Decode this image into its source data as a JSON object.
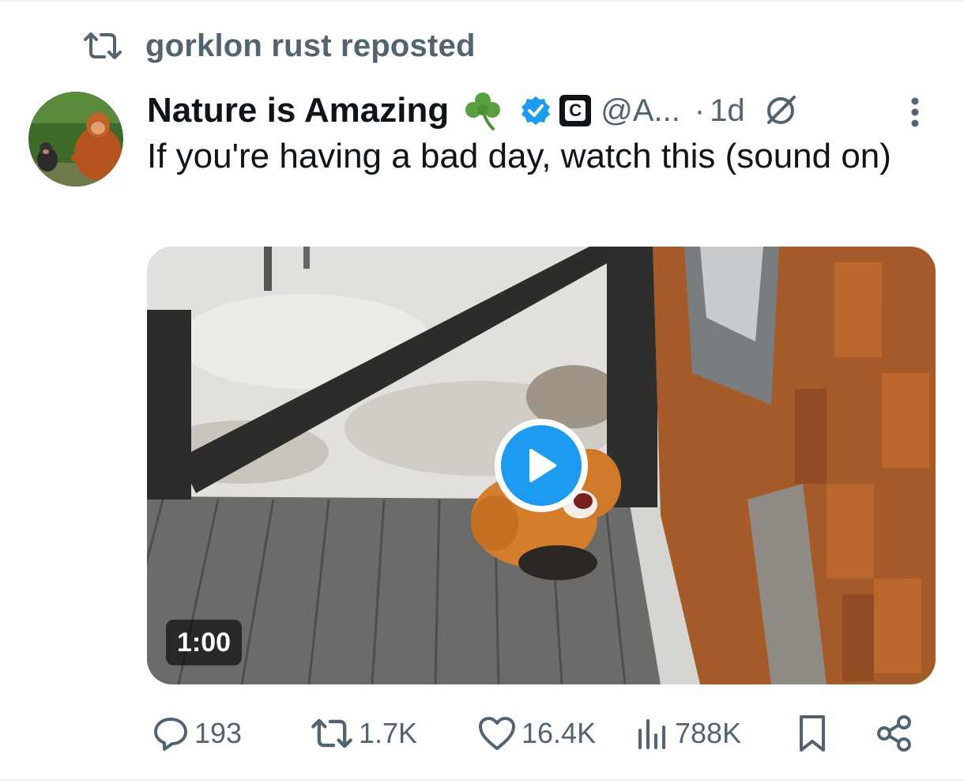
{
  "repost": {
    "text": "gorklon rust reposted",
    "icon": "repost-icon"
  },
  "tweet": {
    "display_name": "Nature is Amazing",
    "name_emoji": "shamrock",
    "handle": "@A...",
    "separator": "·",
    "time": "1d",
    "affiliate_badge_letter": "C",
    "text": "If you're having a bad day, watch this (sound on)"
  },
  "media": {
    "duration": "1:00",
    "play_icon": "play-icon"
  },
  "actions": {
    "replies": "193",
    "reposts": "1.7K",
    "likes": "16.4K",
    "views": "788K"
  },
  "colors": {
    "secondary_text": "#536471",
    "primary_text": "#0f1419",
    "accent_blue": "#1d9bf0"
  }
}
